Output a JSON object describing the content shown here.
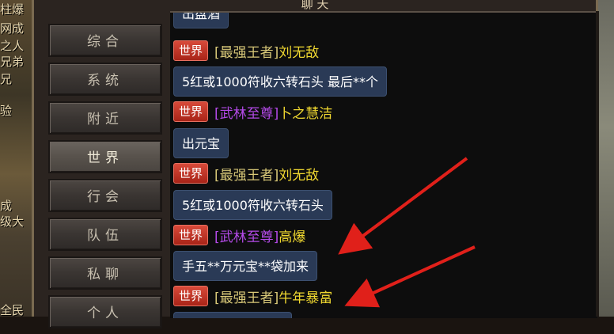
{
  "window": {
    "title": "聊 天"
  },
  "side_texts": [
    "柱爆",
    "网成",
    "之人",
    "兄弟",
    "兄",
    "验",
    "成",
    "级大",
    "全民"
  ],
  "tabs": [
    {
      "label": "综合",
      "active": false
    },
    {
      "label": "系统",
      "active": false
    },
    {
      "label": "附近",
      "active": false
    },
    {
      "label": "世界",
      "active": true
    },
    {
      "label": "行会",
      "active": false
    },
    {
      "label": "队伍",
      "active": false
    },
    {
      "label": "私聊",
      "active": false
    },
    {
      "label": "个人",
      "active": false
    }
  ],
  "chat": {
    "top_partial": "出盘酒",
    "messages": [
      {
        "channel": "世界",
        "title": "[最强王者]",
        "title_color": "yellow",
        "name": "刘无敌",
        "text": "5红或1000符收六转石头 最后**个"
      },
      {
        "channel": "世界",
        "title": "[武林至尊]",
        "title_color": "purple",
        "name": "卜之慧洁",
        "text": "出元宝"
      },
      {
        "channel": "世界",
        "title": "[最强王者]",
        "title_color": "yellow",
        "name": "刘无敌",
        "text": "5红或1000符收六转石头"
      },
      {
        "channel": "世界",
        "title": "[武林至尊]",
        "title_color": "purple",
        "name": "高爆",
        "text": "手五**万元宝**袋加来"
      },
      {
        "channel": "世界",
        "title": "[最强王者]",
        "title_color": "yellow",
        "name": "牛年暴富",
        "text": ""
      }
    ]
  },
  "colors": {
    "badge_red": "#c0302a",
    "name_yellow": "#f0d830",
    "title_purple": "#b44ae8",
    "bubble_blue": "#2a3a56",
    "arrow_red": "#e0201a"
  }
}
